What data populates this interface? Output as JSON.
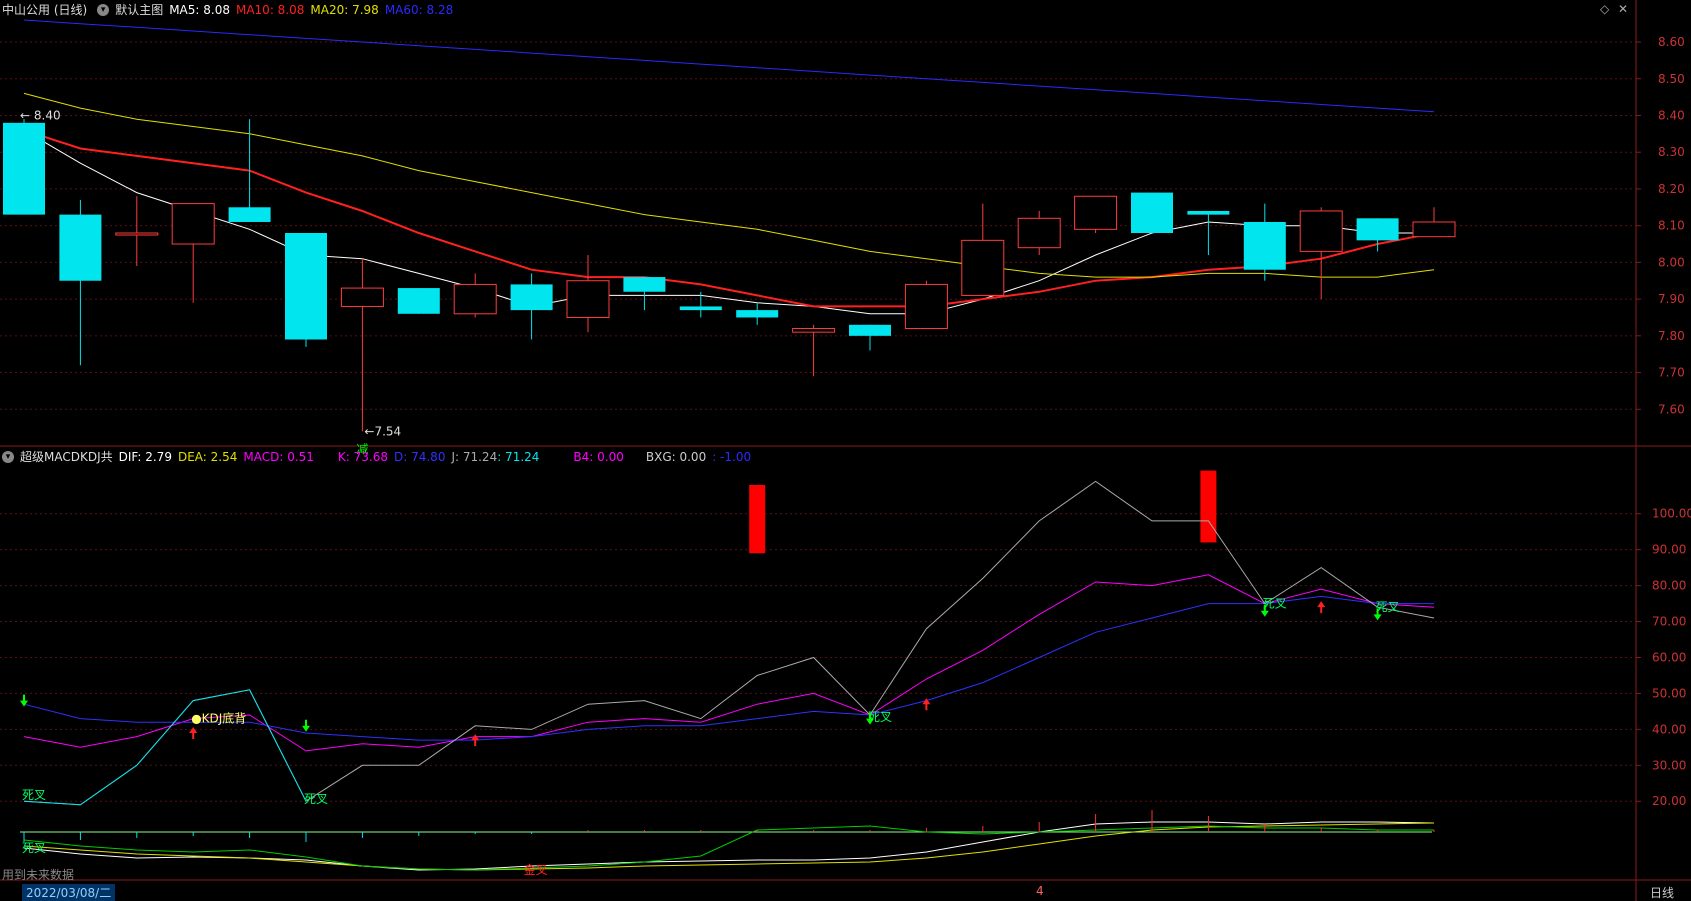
{
  "main_header": {
    "title": "中山公用 (日线)",
    "template": "默认主图",
    "ma5": "MA5: 8.08",
    "ma10": "MA10: 8.08",
    "ma20": "MA20: 7.98",
    "ma60": "MA60: 8.28"
  },
  "ind_header": {
    "name": "超级MACDKDJ共",
    "dif": "DIF: 2.79",
    "dea": "DEA: 2.54",
    "macd": "MACD: 0.51",
    "k": "K: 73.68",
    "d": "D: 74.80",
    "j": "J: 71.24",
    "j2": ": 71.24",
    "b4": "B4: 0.00",
    "bxg": "BXG: 0.00",
    "bxg2": ": -1.00"
  },
  "status": {
    "future_data": "用到未来数据",
    "date": "2022/03/08/二",
    "mark": "4",
    "period": "日线"
  },
  "colors": {
    "up": "#ff3c3c",
    "down": "#00e5ee",
    "ma5": "#ffffff",
    "ma10": "#ff2020",
    "ma20": "#e0e000",
    "ma60": "#2a2aff",
    "k": "#ff00ff",
    "d": "#3030ff",
    "j": "#aaaaaa"
  },
  "chart_data": [
    {
      "type": "candlestick",
      "title": "中山公用 (日线)",
      "price_axis": [
        "8.60",
        "8.50",
        "8.40",
        "8.30",
        "8.20",
        "8.10",
        "8.00",
        "7.90",
        "7.80",
        "7.70",
        "7.60"
      ],
      "ylim": [
        7.5,
        8.66
      ],
      "high_label": "8.40",
      "low_label": "7.54",
      "low_mark": "减",
      "candles": [
        {
          "o": 8.38,
          "h": 8.39,
          "l": 8.13,
          "c": 8.13
        },
        {
          "o": 8.13,
          "h": 8.17,
          "l": 7.72,
          "c": 7.95
        },
        {
          "o": 8.08,
          "h": 8.18,
          "l": 7.99,
          "c": 8.08
        },
        {
          "o": 8.05,
          "h": 8.16,
          "l": 7.89,
          "c": 8.16
        },
        {
          "o": 8.15,
          "h": 8.39,
          "l": 8.11,
          "c": 8.11
        },
        {
          "o": 8.08,
          "h": 8.08,
          "l": 7.77,
          "c": 7.79
        },
        {
          "o": 7.88,
          "h": 8.01,
          "l": 7.54,
          "c": 7.93
        },
        {
          "o": 7.93,
          "h": 7.93,
          "l": 7.86,
          "c": 7.86
        },
        {
          "o": 7.86,
          "h": 7.97,
          "l": 7.85,
          "c": 7.94
        },
        {
          "o": 7.94,
          "h": 7.97,
          "l": 7.79,
          "c": 7.87
        },
        {
          "o": 7.85,
          "h": 8.02,
          "l": 7.81,
          "c": 7.95
        },
        {
          "o": 7.96,
          "h": 7.96,
          "l": 7.87,
          "c": 7.92
        },
        {
          "o": 7.88,
          "h": 7.92,
          "l": 7.85,
          "c": 7.87
        },
        {
          "o": 7.87,
          "h": 7.89,
          "l": 7.83,
          "c": 7.85
        },
        {
          "o": 7.81,
          "h": 7.83,
          "l": 7.69,
          "c": 7.82
        },
        {
          "o": 7.83,
          "h": 7.83,
          "l": 7.76,
          "c": 7.8
        },
        {
          "o": 7.82,
          "h": 7.95,
          "l": 7.82,
          "c": 7.94
        },
        {
          "o": 7.91,
          "h": 8.16,
          "l": 7.91,
          "c": 8.06
        },
        {
          "o": 8.04,
          "h": 8.14,
          "l": 8.02,
          "c": 8.12
        },
        {
          "o": 8.09,
          "h": 8.18,
          "l": 8.08,
          "c": 8.18
        },
        {
          "o": 8.19,
          "h": 8.19,
          "l": 8.08,
          "c": 8.08
        },
        {
          "o": 8.14,
          "h": 8.14,
          "l": 8.02,
          "c": 8.13
        },
        {
          "o": 8.11,
          "h": 8.16,
          "l": 7.95,
          "c": 7.98
        },
        {
          "o": 8.03,
          "h": 8.15,
          "l": 7.9,
          "c": 8.14
        },
        {
          "o": 8.12,
          "h": 8.12,
          "l": 8.03,
          "c": 8.06
        },
        {
          "o": 8.07,
          "h": 8.15,
          "l": 8.07,
          "c": 8.11
        }
      ],
      "series": [
        {
          "name": "MA5",
          "values": [
            8.36,
            8.27,
            8.19,
            8.14,
            8.09,
            8.02,
            8.01,
            7.97,
            7.93,
            7.88,
            7.91,
            7.91,
            7.91,
            7.89,
            7.88,
            7.86,
            7.86,
            7.9,
            7.95,
            8.02,
            8.08,
            8.11,
            8.1,
            8.1,
            8.08,
            8.08
          ]
        },
        {
          "name": "MA10",
          "values": [
            8.36,
            8.31,
            8.29,
            8.27,
            8.25,
            8.19,
            8.14,
            8.08,
            8.03,
            7.98,
            7.96,
            7.96,
            7.94,
            7.91,
            7.88,
            7.88,
            7.88,
            7.9,
            7.92,
            7.95,
            7.96,
            7.98,
            7.99,
            8.01,
            8.05,
            8.08
          ]
        },
        {
          "name": "MA20",
          "values": [
            8.46,
            8.42,
            8.39,
            8.37,
            8.35,
            8.32,
            8.29,
            8.25,
            8.22,
            8.19,
            8.16,
            8.13,
            8.11,
            8.09,
            8.06,
            8.03,
            8.01,
            7.99,
            7.97,
            7.96,
            7.96,
            7.97,
            7.97,
            7.96,
            7.96,
            7.98
          ]
        },
        {
          "name": "MA60",
          "values": [
            8.66,
            8.65,
            8.64,
            8.63,
            8.62,
            8.61,
            8.6,
            8.59,
            8.58,
            8.57,
            8.56,
            8.55,
            8.54,
            8.53,
            8.52,
            8.51,
            8.5,
            8.49,
            8.48,
            8.47,
            8.46,
            8.45,
            8.44,
            8.43,
            8.42,
            8.41
          ]
        }
      ]
    },
    {
      "type": "line",
      "title": "超级MACDKDJ共",
      "value_axis": [
        "100.00",
        "90.00",
        "80.00",
        "70.00",
        "60.00",
        "50.00",
        "40.00",
        "30.00",
        "20.00"
      ],
      "ylim": [
        12,
        113
      ],
      "series": [
        {
          "name": "K",
          "values": [
            38,
            35,
            38,
            43,
            44,
            34,
            36,
            35,
            38,
            38,
            42,
            43,
            42,
            47,
            50,
            44,
            54,
            62,
            72,
            81,
            80,
            83,
            75,
            79,
            75,
            74
          ]
        },
        {
          "name": "D",
          "values": [
            47,
            43,
            42,
            42,
            42,
            39,
            38,
            37,
            37,
            38,
            40,
            41,
            41,
            43,
            45,
            44,
            48,
            53,
            60,
            67,
            71,
            75,
            75,
            77,
            75,
            75
          ]
        },
        {
          "name": "J",
          "values": [
            20,
            19,
            30,
            48,
            51,
            20,
            30,
            30,
            41,
            40,
            47,
            48,
            43,
            55,
            60,
            44,
            68,
            82,
            98,
            109,
            98,
            98,
            75,
            85,
            74,
            71
          ]
        }
      ],
      "bars": [
        {
          "index": 13,
          "from": 89,
          "to": 108
        },
        {
          "index": 21,
          "from": 92,
          "to": 112
        }
      ],
      "annotations": [
        {
          "index": 0,
          "text": "死叉"
        },
        {
          "index": 3,
          "text": "KDJ底背"
        },
        {
          "index": 5,
          "text": "死叉"
        },
        {
          "index": 15,
          "text": "死叉"
        },
        {
          "index": 22,
          "text": "死叉"
        },
        {
          "index": 24,
          "text": "死叉"
        },
        {
          "index": 9,
          "text": "金叉"
        },
        {
          "index": 0,
          "text": "死叉"
        }
      ]
    }
  ]
}
